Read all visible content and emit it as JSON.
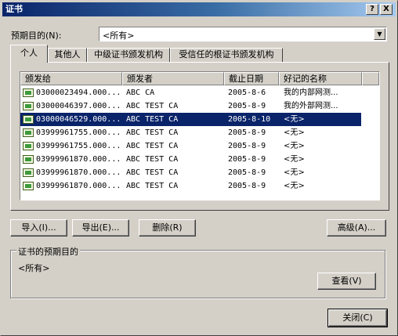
{
  "window": {
    "title": "证书"
  },
  "title_buttons": {
    "help": "?",
    "close": "X"
  },
  "purpose": {
    "label": "预期目的(N):",
    "selected": "<所有>"
  },
  "tabs": [
    {
      "label": "个人"
    },
    {
      "label": "其他人"
    },
    {
      "label": "中级证书颁发机构"
    },
    {
      "label": "受信任的根证书颁发机构"
    }
  ],
  "columns": {
    "issued_to": "颁发给",
    "issuer": "颁发者",
    "expiration": "截止日期",
    "friendly_name": "好记的名称"
  },
  "rows": [
    {
      "issued_to": "03000023494.000...",
      "issuer": "ABC CA",
      "expiration": "2005-8-6",
      "friendly_name": "我的内部网测..."
    },
    {
      "issued_to": "03000046397.000...",
      "issuer": "ABC TEST CA",
      "expiration": "2005-8-9",
      "friendly_name": "我的外部网测..."
    },
    {
      "issued_to": "03000046529.000...",
      "issuer": "ABC TEST CA",
      "expiration": "2005-8-10",
      "friendly_name": "<无>"
    },
    {
      "issued_to": "03999961755.000...",
      "issuer": "ABC TEST CA",
      "expiration": "2005-8-9",
      "friendly_name": "<无>"
    },
    {
      "issued_to": "03999961755.000...",
      "issuer": "ABC TEST CA",
      "expiration": "2005-8-9",
      "friendly_name": "<无>"
    },
    {
      "issued_to": "03999961870.000...",
      "issuer": "ABC TEST CA",
      "expiration": "2005-8-9",
      "friendly_name": "<无>"
    },
    {
      "issued_to": "03999961870.000...",
      "issuer": "ABC TEST CA",
      "expiration": "2005-8-9",
      "friendly_name": "<无>"
    },
    {
      "issued_to": "03999961870.000...",
      "issuer": "ABC TEST CA",
      "expiration": "2005-8-9",
      "friendly_name": "<无>"
    }
  ],
  "buttons": {
    "import": "导入(I)...",
    "export": "导出(E)...",
    "remove": "删除(R)",
    "advanced": "高级(A)...",
    "view": "查看(V)",
    "close": "关闭(C)"
  },
  "purposes_group": {
    "title": "证书的预期目的",
    "value": "<所有>"
  }
}
